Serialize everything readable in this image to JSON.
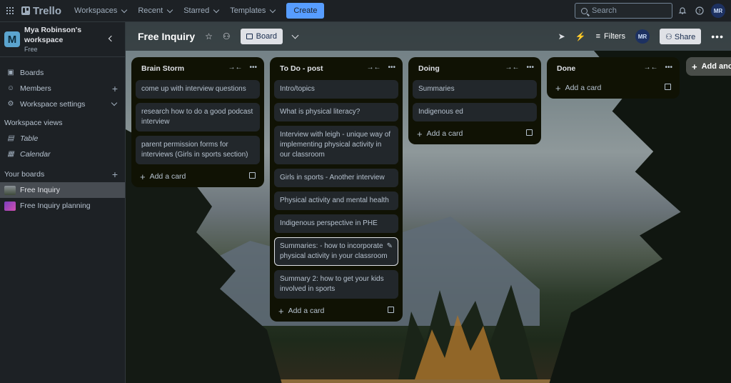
{
  "nav": {
    "logo": "Trello",
    "menus": [
      "Workspaces",
      "Recent",
      "Starred",
      "Templates"
    ],
    "create_label": "Create",
    "search_placeholder": "Search",
    "user_initials": "MR"
  },
  "sidebar": {
    "workspace_initial": "M",
    "workspace_name": "Mya Robinson's workspace",
    "workspace_plan": "Free",
    "links": [
      "Boards",
      "Members",
      "Workspace settings"
    ],
    "views_heading": "Workspace views",
    "views": [
      "Table",
      "Calendar"
    ],
    "boards_heading": "Your boards",
    "boards": [
      {
        "name": "Free Inquiry",
        "active": true,
        "thumb_color": "#6b6f63"
      },
      {
        "name": "Free Inquiry planning",
        "active": false,
        "thumb_color": "#7b3fbf"
      }
    ]
  },
  "board": {
    "title": "Free Inquiry",
    "view_label": "Board",
    "filters_label": "Filters",
    "member_initials": "MR",
    "share_label": "Share",
    "add_list_label": "Add another list"
  },
  "lists": [
    {
      "title": "Brain Storm",
      "cards": [
        "come up with interview questions",
        "research how to do a good podcast interview",
        "parent permission forms for interviews (Girls in sports section)"
      ],
      "add_label": "Add a card"
    },
    {
      "title": "To Do - post",
      "cards": [
        "Intro/topics",
        "What is physical literacy?",
        "Interview with leigh - unique way of implementing physical activity in our classroom",
        "Girls in sports - Another interview",
        "Physical activity and mental health",
        "Indigenous perspective in PHE",
        "Summaries: - how to incorporate physical activity in your classroom",
        "Summary 2: how to get your kids involved in sports"
      ],
      "add_label": "Add a card"
    },
    {
      "title": "Doing",
      "cards": [
        "Summaries",
        "Indigenous ed"
      ],
      "add_label": "Add a card"
    },
    {
      "title": "Done",
      "cards": [],
      "add_label": "Add a card"
    }
  ],
  "colors": {
    "accent": "#579dff",
    "list_bg": "#101204",
    "card_bg": "#22272b"
  }
}
